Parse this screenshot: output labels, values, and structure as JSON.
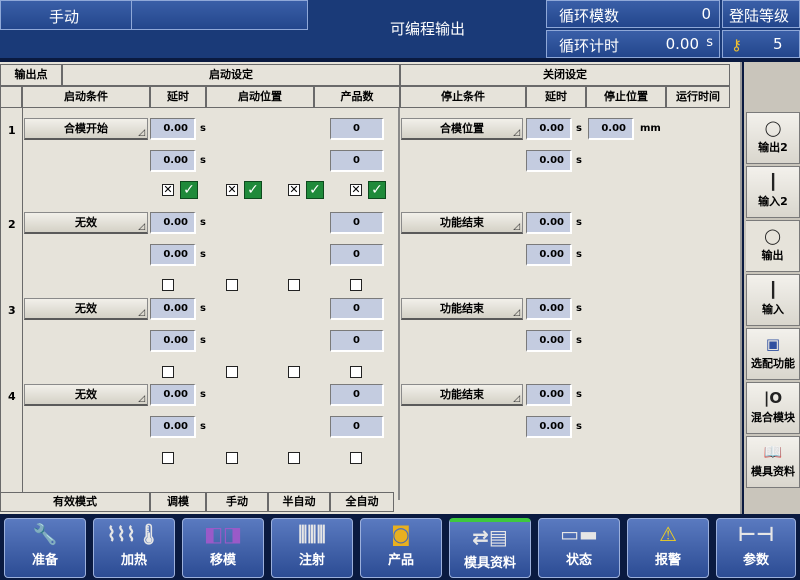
{
  "header": {
    "mode": "手动",
    "title": "可编程输出",
    "cycle_count_label": "循环模数",
    "cycle_count_value": "0",
    "cycle_timer_label": "循环计时",
    "cycle_timer_value": "0.00",
    "cycle_timer_unit": "s",
    "login_label": "登陆等级",
    "login_level": "5"
  },
  "table": {
    "col_output": "输出点",
    "group_start": "启动设定",
    "group_close": "关闭设定",
    "h_start_cond": "启动条件",
    "h_delay": "延时",
    "h_start_pos": "启动位置",
    "h_product_count": "产品数",
    "h_stop_cond": "停止条件",
    "h_delay2": "延时",
    "h_stop_pos": "停止位置",
    "h_run_time": "运行时间",
    "sec": "s",
    "mm": "mm",
    "rows": [
      {
        "num": "1",
        "start_cond": "合模开始",
        "delay1": "0.00",
        "delay2": "0.00",
        "count1": "0",
        "count2": "0",
        "stop_cond": "合模位置",
        "sdelay1": "0.00",
        "sdelay2": "0.00",
        "stop_pos": "0.00",
        "checks": [
          true,
          true,
          true,
          true
        ]
      },
      {
        "num": "2",
        "start_cond": "无效",
        "delay1": "0.00",
        "delay2": "0.00",
        "count1": "0",
        "count2": "0",
        "stop_cond": "功能结束",
        "sdelay1": "0.00",
        "sdelay2": "0.00",
        "checks": [
          false,
          false,
          false,
          false
        ]
      },
      {
        "num": "3",
        "start_cond": "无效",
        "delay1": "0.00",
        "delay2": "0.00",
        "count1": "0",
        "count2": "0",
        "stop_cond": "功能结束",
        "sdelay1": "0.00",
        "sdelay2": "0.00",
        "checks": [
          false,
          false,
          false,
          false
        ]
      },
      {
        "num": "4",
        "start_cond": "无效",
        "delay1": "0.00",
        "delay2": "0.00",
        "count1": "0",
        "count2": "0",
        "stop_cond": "功能结束",
        "sdelay1": "0.00",
        "sdelay2": "0.00",
        "checks": [
          false,
          false,
          false,
          false
        ]
      }
    ],
    "footer": {
      "valid_mode": "有效模式",
      "mode_adjust": "调模",
      "mode_manual": "手动",
      "mode_semi": "半自动",
      "mode_full": "全自动"
    }
  },
  "side": [
    {
      "label": "输出2",
      "icon": "output-icon"
    },
    {
      "label": "输入2",
      "icon": "input-icon"
    },
    {
      "label": "输出",
      "icon": "output-icon"
    },
    {
      "label": "输入",
      "icon": "input-icon"
    },
    {
      "label": "选配功能",
      "icon": "computer-icon"
    },
    {
      "label": "混合模块",
      "icon": "io-icon"
    },
    {
      "label": "模具资料",
      "icon": "book-icon"
    }
  ],
  "nav": [
    {
      "label": "准备",
      "icon": "wrench-icon"
    },
    {
      "label": "加热",
      "icon": "heater-icon"
    },
    {
      "label": "移模",
      "icon": "mold-move-icon"
    },
    {
      "label": "注射",
      "icon": "screw-icon"
    },
    {
      "label": "产品",
      "icon": "product-icon"
    },
    {
      "label": "模具资料",
      "icon": "mold-data-icon"
    },
    {
      "label": "状态",
      "icon": "status-icon"
    },
    {
      "label": "报警",
      "icon": "warning-icon"
    },
    {
      "label": "参数",
      "icon": "caliper-icon"
    }
  ],
  "colors": {
    "header_bg": "#1a3a78",
    "panel_bg": "#e6e3da",
    "active_tab": "#3ec83e"
  }
}
